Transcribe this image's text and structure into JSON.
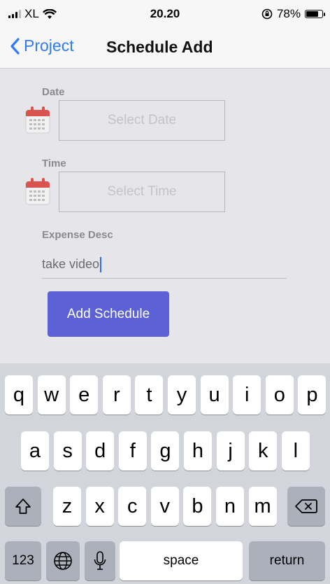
{
  "status_bar": {
    "carrier": "XL",
    "time": "20.20",
    "battery": "78%",
    "battery_level": 0.78
  },
  "nav": {
    "back_label": "Project",
    "title": "Schedule Add"
  },
  "form": {
    "date_label": "Date",
    "date_placeholder": "Select Date",
    "time_label": "Time",
    "time_placeholder": "Select Time",
    "expense_label": "Expense Desc",
    "expense_value": "take video",
    "submit_label": "Add Schedule"
  },
  "keyboard": {
    "row1": [
      "q",
      "w",
      "e",
      "r",
      "t",
      "y",
      "u",
      "i",
      "o",
      "p"
    ],
    "row2": [
      "a",
      "s",
      "d",
      "f",
      "g",
      "h",
      "j",
      "k",
      "l"
    ],
    "row3": [
      "z",
      "x",
      "c",
      "v",
      "b",
      "n",
      "m"
    ],
    "numbers_label": "123",
    "space_label": "space",
    "return_label": "return"
  },
  "colors": {
    "accent": "#2f7cf6",
    "button": "#5c62d6",
    "calendar": "#d9534f"
  },
  "icons": [
    "signal-icon",
    "wifi-icon",
    "lock-rotation-icon",
    "battery-icon",
    "back-chevron-icon",
    "calendar-icon",
    "shift-icon",
    "delete-icon",
    "globe-icon",
    "microphone-icon"
  ]
}
